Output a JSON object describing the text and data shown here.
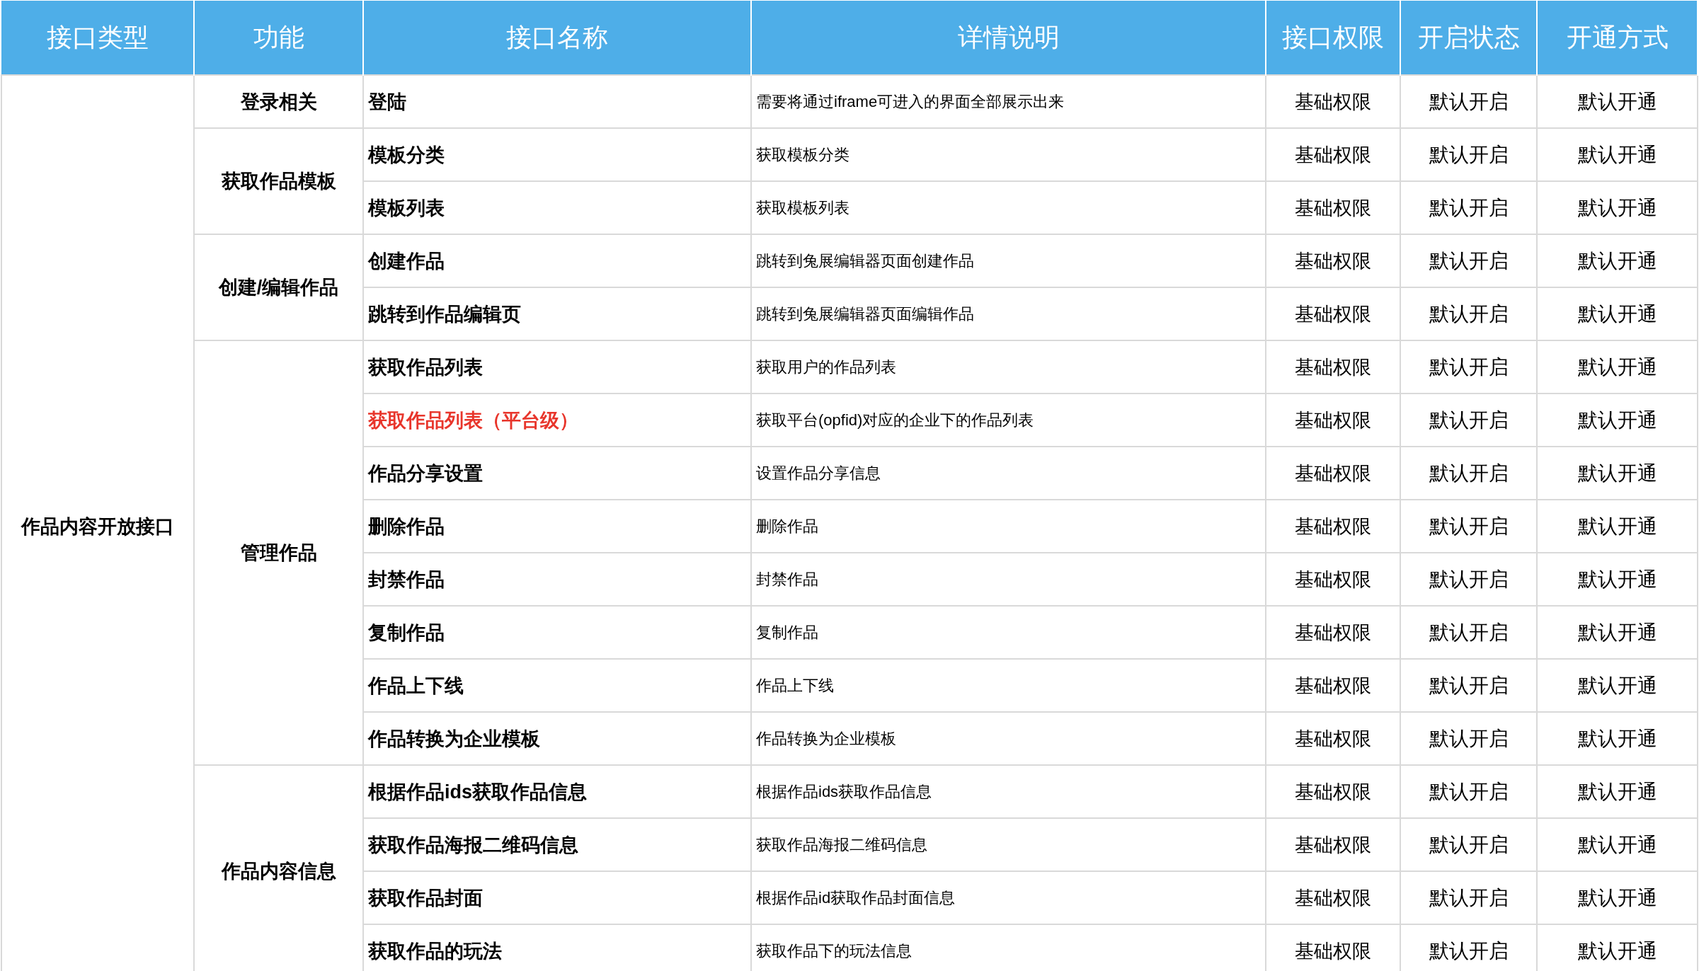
{
  "table": {
    "columns": [
      "接口类型",
      "功能",
      "接口名称",
      "详情说明",
      "接口权限",
      "开启状态",
      "开通方式"
    ],
    "groups": [
      {
        "type": "作品内容开放接口",
        "functions": [
          {
            "name": "登录相关",
            "rows": [
              {
                "name": "登陆",
                "color": "#000000",
                "detail": "需要将通过iframe可进入的界面全部展示出来",
                "permission": "基础权限",
                "status": "默认开启",
                "method": "默认开通"
              }
            ]
          },
          {
            "name": "获取作品模板",
            "rows": [
              {
                "name": "模板分类",
                "color": "#000000",
                "detail": "获取模板分类",
                "permission": "基础权限",
                "status": "默认开启",
                "method": "默认开通"
              },
              {
                "name": "模板列表",
                "color": "#000000",
                "detail": "获取模板列表",
                "permission": "基础权限",
                "status": "默认开启",
                "method": "默认开通"
              }
            ]
          },
          {
            "name": "创建/编辑作品",
            "rows": [
              {
                "name": "创建作品",
                "color": "#000000",
                "detail": "跳转到兔展编辑器页面创建作品",
                "permission": "基础权限",
                "status": "默认开启",
                "method": "默认开通"
              },
              {
                "name": "跳转到作品编辑页",
                "color": "#000000",
                "detail": "跳转到兔展编辑器页面编辑作品",
                "permission": "基础权限",
                "status": "默认开启",
                "method": "默认开通"
              }
            ]
          },
          {
            "name": "管理作品",
            "rows": [
              {
                "name": "获取作品列表",
                "color": "#000000",
                "detail": "获取用户的作品列表",
                "permission": "基础权限",
                "status": "默认开启",
                "method": "默认开通"
              },
              {
                "name": "获取作品列表（平台级）",
                "color": "#e8352b",
                "detail": "获取平台(opfid)对应的企业下的作品列表",
                "permission": "基础权限",
                "status": "默认开启",
                "method": "默认开通"
              },
              {
                "name": "作品分享设置",
                "color": "#000000",
                "detail": "设置作品分享信息",
                "permission": "基础权限",
                "status": "默认开启",
                "method": "默认开通"
              },
              {
                "name": "删除作品",
                "color": "#000000",
                "detail": "删除作品",
                "permission": "基础权限",
                "status": "默认开启",
                "method": "默认开通"
              },
              {
                "name": "封禁作品",
                "color": "#000000",
                "detail": "封禁作品",
                "permission": "基础权限",
                "status": "默认开启",
                "method": "默认开通"
              },
              {
                "name": "复制作品",
                "color": "#000000",
                "detail": "复制作品",
                "permission": "基础权限",
                "status": "默认开启",
                "method": "默认开通"
              },
              {
                "name": "作品上下线",
                "color": "#000000",
                "detail": "作品上下线",
                "permission": "基础权限",
                "status": "默认开启",
                "method": "默认开通"
              },
              {
                "name": "作品转换为企业模板",
                "color": "#000000",
                "detail": "作品转换为企业模板",
                "permission": "基础权限",
                "status": "默认开启",
                "method": "默认开通"
              }
            ]
          },
          {
            "name": "作品内容信息",
            "rows": [
              {
                "name": "根据作品ids获取作品信息",
                "color": "#000000",
                "detail": "根据作品ids获取作品信息",
                "permission": "基础权限",
                "status": "默认开启",
                "method": "默认开通"
              },
              {
                "name": "获取作品海报二维码信息",
                "color": "#000000",
                "detail": "获取作品海报二维码信息",
                "permission": "基础权限",
                "status": "默认开启",
                "method": "默认开通"
              },
              {
                "name": "获取作品封面",
                "color": "#000000",
                "detail": "根据作品id获取作品封面信息",
                "permission": "基础权限",
                "status": "默认开启",
                "method": "默认开通"
              },
              {
                "name": "获取作品的玩法",
                "color": "#000000",
                "detail": "获取作品下的玩法信息",
                "permission": "基础权限",
                "status": "默认开启",
                "method": "默认开通"
              }
            ]
          }
        ]
      }
    ]
  }
}
